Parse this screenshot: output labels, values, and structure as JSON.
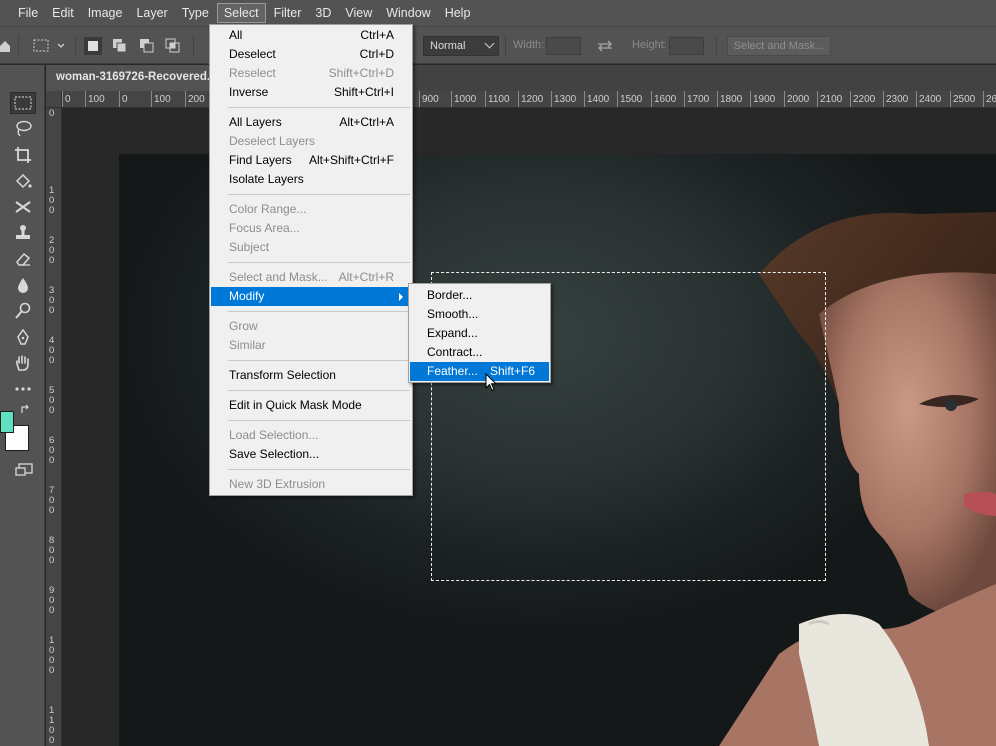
{
  "menubar": {
    "items": [
      "File",
      "Edit",
      "Image",
      "Layer",
      "Type",
      "Select",
      "Filter",
      "3D",
      "View",
      "Window",
      "Help"
    ],
    "active": "Select"
  },
  "options": {
    "style_value": "Normal",
    "width_label": "Width:",
    "height_label": "Height:",
    "select_mask_label": "Select and Mask..."
  },
  "document": {
    "tab_title": "woman-3169726-Recovered.jp"
  },
  "ruler": {
    "h_ticks": [
      "0",
      "100",
      "0",
      "100",
      "200",
      "900",
      "1000",
      "1100",
      "1200",
      "1300",
      "1400",
      "1500",
      "1600",
      "1700",
      "1800",
      "1900",
      "2000",
      "2100",
      "2200",
      "2300",
      "2400",
      "2500",
      "26"
    ],
    "v_ticks": [
      "0",
      "1 0 0",
      "2 0 0",
      "3 0 0",
      "4 0 0",
      "5 0 0",
      "6 0 0",
      "7 0 0",
      "8 0 0",
      "9 0 0",
      "1 0 0 0",
      "1 1 0 0"
    ]
  },
  "select_menu": {
    "items": [
      {
        "label": "All",
        "shortcut": "Ctrl+A",
        "enabled": true
      },
      {
        "label": "Deselect",
        "shortcut": "Ctrl+D",
        "enabled": true
      },
      {
        "label": "Reselect",
        "shortcut": "Shift+Ctrl+D",
        "enabled": false
      },
      {
        "label": "Inverse",
        "shortcut": "Shift+Ctrl+I",
        "enabled": true
      },
      {
        "label": "All Layers",
        "shortcut": "Alt+Ctrl+A",
        "enabled": true
      },
      {
        "label": "Deselect Layers",
        "shortcut": "",
        "enabled": false
      },
      {
        "label": "Find Layers",
        "shortcut": "Alt+Shift+Ctrl+F",
        "enabled": true
      },
      {
        "label": "Isolate Layers",
        "shortcut": "",
        "enabled": true
      },
      {
        "label": "Color Range...",
        "shortcut": "",
        "enabled": false
      },
      {
        "label": "Focus Area...",
        "shortcut": "",
        "enabled": false
      },
      {
        "label": "Subject",
        "shortcut": "",
        "enabled": false
      },
      {
        "label": "Select and Mask...",
        "shortcut": "Alt+Ctrl+R",
        "enabled": false
      },
      {
        "label": "Modify",
        "shortcut": "",
        "enabled": true,
        "highlighted": true,
        "submenu": true
      },
      {
        "label": "Grow",
        "shortcut": "",
        "enabled": false
      },
      {
        "label": "Similar",
        "shortcut": "",
        "enabled": false
      },
      {
        "label": "Transform Selection",
        "shortcut": "",
        "enabled": true
      },
      {
        "label": "Edit in Quick Mask Mode",
        "shortcut": "",
        "enabled": true
      },
      {
        "label": "Load Selection...",
        "shortcut": "",
        "enabled": false
      },
      {
        "label": "Save Selection...",
        "shortcut": "",
        "enabled": true
      },
      {
        "label": "New 3D Extrusion",
        "shortcut": "",
        "enabled": false
      }
    ]
  },
  "modify_submenu": {
    "items": [
      {
        "label": "Border...",
        "shortcut": ""
      },
      {
        "label": "Smooth...",
        "shortcut": ""
      },
      {
        "label": "Expand...",
        "shortcut": ""
      },
      {
        "label": "Contract...",
        "shortcut": ""
      },
      {
        "label": "Feather...",
        "shortcut": "Shift+F6",
        "highlighted": true
      }
    ]
  },
  "colors": {
    "foreground": "#5fe0c0",
    "background": "#ffffff",
    "menu_highlight": "#0078d7"
  }
}
